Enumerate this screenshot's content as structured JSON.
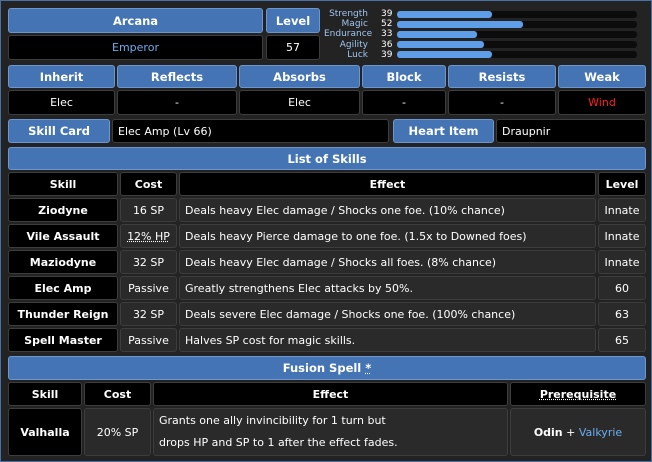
{
  "header": {
    "arcana_label": "Arcana",
    "arcana_value": "Emperor",
    "level_label": "Level",
    "level_value": "57"
  },
  "stats": [
    {
      "name": "Strength",
      "value": 39
    },
    {
      "name": "Magic",
      "value": 52
    },
    {
      "name": "Endurance",
      "value": 33
    },
    {
      "name": "Agility",
      "value": 36
    },
    {
      "name": "Luck",
      "value": 39
    }
  ],
  "stat_max": 99,
  "affinities": {
    "headers": [
      "Inherit",
      "Reflects",
      "Absorbs",
      "Block",
      "Resists",
      "Weak"
    ],
    "values": [
      "Elec",
      "-",
      "Elec",
      "-",
      "-",
      "Wind"
    ]
  },
  "items": {
    "skill_card_label": "Skill Card",
    "skill_card_value": "Elec Amp (Lv 66)",
    "heart_item_label": "Heart Item",
    "heart_item_value": "Draupnir"
  },
  "skills": {
    "title": "List of Skills",
    "columns": [
      "Skill",
      "Cost",
      "Effect",
      "Level"
    ],
    "rows": [
      {
        "skill": "Ziodyne",
        "cost": "16 SP",
        "effect": "Deals heavy Elec damage / Shocks one foe. (10% chance)",
        "level": "Innate"
      },
      {
        "skill": "Vile Assault",
        "cost": "12% HP",
        "effect": "Deals heavy Pierce damage to one foe. (1.5x to Downed foes)",
        "level": "Innate"
      },
      {
        "skill": "Maziodyne",
        "cost": "32 SP",
        "effect": "Deals heavy Elec damage / Shocks all foes. (8% chance)",
        "level": "Innate"
      },
      {
        "skill": "Elec Amp",
        "cost": "Passive",
        "effect": "Greatly strengthens Elec attacks by 50%.",
        "level": "60"
      },
      {
        "skill": "Thunder Reign",
        "cost": "32 SP",
        "effect": "Deals severe Elec damage / Shocks one foe. (100% chance)",
        "level": "63"
      },
      {
        "skill": "Spell Master",
        "cost": "Passive",
        "effect": "Halves SP cost for magic skills.",
        "level": "65"
      }
    ]
  },
  "fusion": {
    "title": "Fusion Spell",
    "title_mark": "*",
    "columns": [
      "Skill",
      "Cost",
      "Effect",
      "Prerequisite"
    ],
    "skill": "Valhalla",
    "cost": "20% SP",
    "effect_line1": "Grants one ally invincibility for 1 turn but",
    "effect_line2": "drops HP and SP to 1 after the effect fades.",
    "prereq_1": "Odin",
    "prereq_plus": "+",
    "prereq_2": "Valkyrie"
  },
  "colors": {
    "header_bg": "#4474b3",
    "cell_bg": "#000000",
    "row_bg": "#2a2a2a",
    "link_blue": "#6aaef0",
    "weak_red": "#ff2020",
    "bar_fill": "#5e9ee8"
  }
}
